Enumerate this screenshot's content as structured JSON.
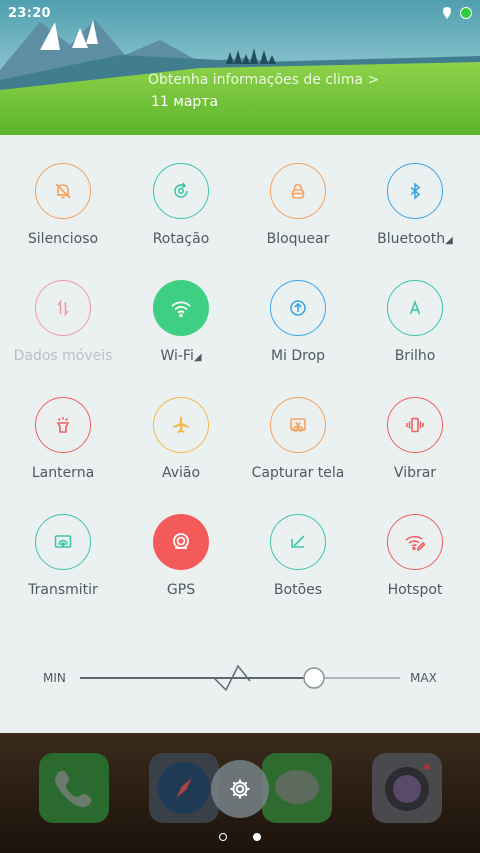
{
  "status_bar": {
    "time": "23:20"
  },
  "header": {
    "weather_link": "Obtenha informações de clima >",
    "date": "11 марта"
  },
  "colors": {
    "orange": "#f5a25d",
    "teal": "#3cc8a6",
    "blue": "#3aa7e6",
    "pink": "#f19aa3",
    "green_active": "#3fcf82",
    "red": "#f06060",
    "yellow": "#f5b94a",
    "red_active": "#f55a5a"
  },
  "toggles": [
    {
      "label": "Silencioso",
      "icon": "bell-muted-icon",
      "color": "#f5a25d"
    },
    {
      "label": "Rotação",
      "icon": "rotation-icon",
      "color": "#3cc8a6"
    },
    {
      "label": "Bloquear",
      "icon": "lock-icon",
      "color": "#f5a25d"
    },
    {
      "label": "Bluetooth",
      "icon": "bluetooth-icon",
      "color": "#3aa7e6"
    },
    {
      "label": "Dados móveis",
      "icon": "mobile-data-icon",
      "color": "#f19aa3"
    },
    {
      "label": "Wi-Fi",
      "icon": "wifi-icon",
      "color": "#3fcf82"
    },
    {
      "label": "Mi Drop",
      "icon": "mi-drop-icon",
      "color": "#3aa7e6"
    },
    {
      "label": "Brilho",
      "icon": "brightness-auto-icon",
      "color": "#3cc8a6"
    },
    {
      "label": "Lanterna",
      "icon": "flashlight-icon",
      "color": "#f06060"
    },
    {
      "label": "Avião",
      "icon": "airplane-icon",
      "color": "#f5b94a"
    },
    {
      "label": "Capturar tela",
      "icon": "screenshot-icon",
      "color": "#f5a25d"
    },
    {
      "label": "Vibrar",
      "icon": "vibrate-icon",
      "color": "#f06060"
    },
    {
      "label": "Transmitir",
      "icon": "cast-icon",
      "color": "#3cc8a6"
    },
    {
      "label": "GPS",
      "icon": "gps-icon",
      "color": "#f55a5a"
    },
    {
      "label": "Botões",
      "icon": "buttons-icon",
      "color": "#3cc8a6"
    },
    {
      "label": "Hotspot",
      "icon": "hotspot-icon",
      "color": "#f06060"
    }
  ],
  "brightness": {
    "min_label": "MIN",
    "max_label": "MAX",
    "level": 0.73
  }
}
